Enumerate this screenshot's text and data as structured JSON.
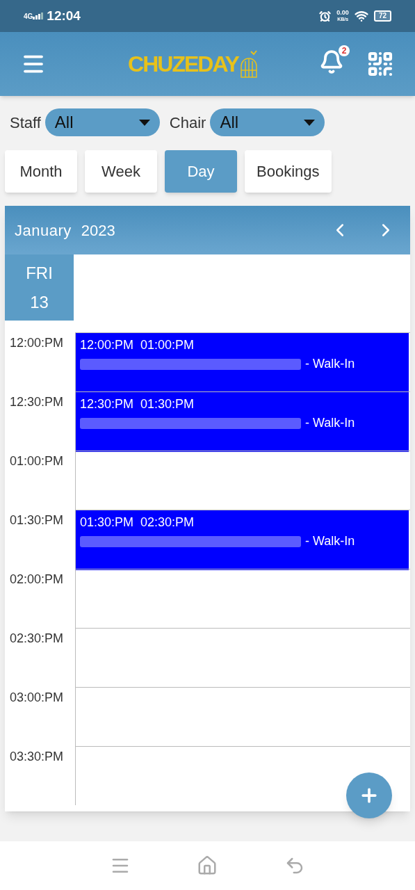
{
  "status_bar": {
    "network": "4G",
    "time": "12:04",
    "speed": "0.00",
    "speed_unit": "KB/s",
    "battery": "72"
  },
  "header": {
    "logo": "CHUZEDAY",
    "notifications": "2"
  },
  "filters": [
    {
      "label": "Staff",
      "value": "All"
    },
    {
      "label": "Chair",
      "value": "All"
    }
  ],
  "views": [
    {
      "label": "Month",
      "selected": false
    },
    {
      "label": "Week",
      "selected": false
    },
    {
      "label": "Day",
      "selected": true
    },
    {
      "label": "Bookings",
      "selected": false
    }
  ],
  "calendar": {
    "month": "January",
    "year": "2023",
    "day_name": "FRI",
    "day_number": "13",
    "slots": [
      {
        "time": "12:00:PM",
        "event": {
          "start": "12:00:PM",
          "end": "01:00:PM",
          "source": "- Walk-In",
          "color": "#0000ff"
        }
      },
      {
        "time": "12:30:PM",
        "event": {
          "start": "12:30:PM",
          "end": "01:30:PM",
          "source": "- Walk-In",
          "color": "#0000ff"
        }
      },
      {
        "time": "01:00:PM"
      },
      {
        "time": "01:30:PM",
        "event": {
          "start": "01:30:PM",
          "end": "02:30:PM",
          "source": "- Walk-In",
          "color": "#0000ff"
        }
      },
      {
        "time": "02:00:PM"
      },
      {
        "time": "02:30:PM"
      },
      {
        "time": "03:00:PM"
      },
      {
        "time": "03:30:PM"
      }
    ]
  }
}
